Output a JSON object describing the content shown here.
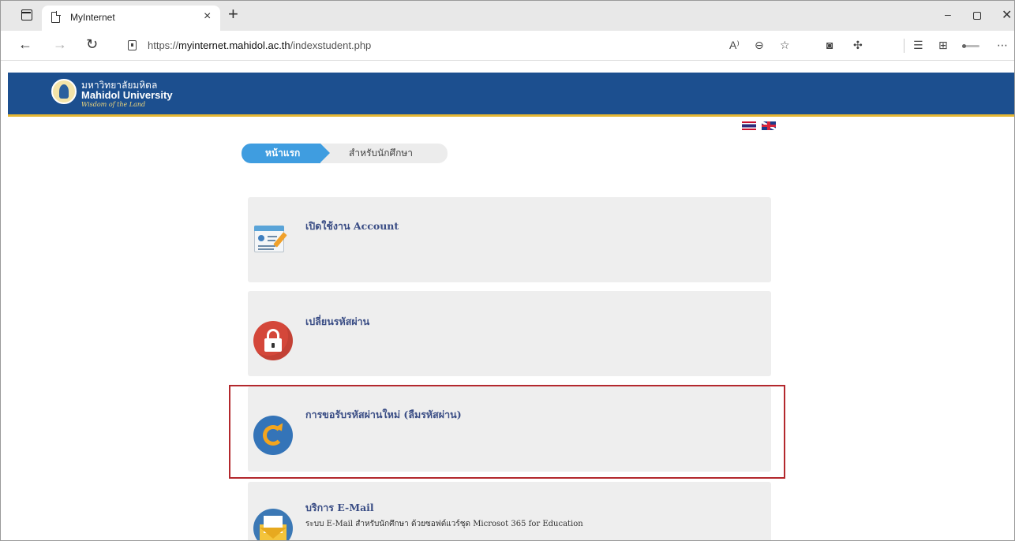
{
  "browser": {
    "tab_title": "MyInternet",
    "tab_close": "×",
    "new_tab": "+",
    "url_prefix": "https://",
    "url_host": "myinternet.mahidol.ac.th",
    "url_path": "/indexstudent.php",
    "window_minimize": "–",
    "window_close": "✕"
  },
  "site": {
    "logo_thai": "มหาวิทยาลัยมหิดล",
    "logo_english": "Mahidol University",
    "logo_tagline": "Wisdom of the Land",
    "breadcrumb": {
      "home": "หน้าแรก",
      "current": "สำหรับนักศึกษา"
    },
    "menu": [
      {
        "title": "เปิดใช้งาน Account",
        "description": "",
        "icon": "account-card-icon"
      },
      {
        "title": "เปลี่ยนรหัสผ่าน",
        "description": "",
        "icon": "padlock-icon"
      },
      {
        "title": "การขอรับรหัสผ่านใหม่ (ลืมรหัสผ่าน)",
        "description": "",
        "icon": "reset-password-icon"
      },
      {
        "title": "บริการ E-Mail",
        "description": "ระบบ E-Mail สำหรับนักศึกษา ด้วยซอฟต์แวร์ชุด Microsot 365 for Education",
        "icon": "mail-icon"
      }
    ]
  },
  "colors": {
    "header_blue": "#1c4f8f",
    "header_gold": "#e5b733",
    "breadcrumb_blue": "#3f9de0",
    "card_gray": "#eeeeee",
    "highlight_red": "#b3282d"
  }
}
